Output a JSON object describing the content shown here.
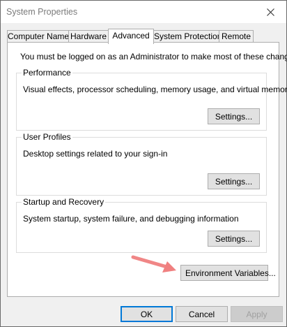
{
  "window": {
    "title": "System Properties"
  },
  "icons": {
    "close": "close-icon",
    "arrow": "pointer-arrow-icon"
  },
  "colors": {
    "arrow": "#f08080",
    "focus": "#0078d7"
  },
  "tabs": [
    {
      "label": "Computer Name",
      "active": false
    },
    {
      "label": "Hardware",
      "active": false
    },
    {
      "label": "Advanced",
      "active": true
    },
    {
      "label": "System Protection",
      "active": false
    },
    {
      "label": "Remote",
      "active": false
    }
  ],
  "advanced": {
    "notice": "You must be logged on as an Administrator to make most of these changes.",
    "performance": {
      "title": "Performance",
      "description": "Visual effects, processor scheduling, memory usage, and virtual memory",
      "button": "Settings..."
    },
    "user_profiles": {
      "title": "User Profiles",
      "description": "Desktop settings related to your sign-in",
      "button": "Settings..."
    },
    "startup_recovery": {
      "title": "Startup and Recovery",
      "description": "System startup, system failure, and debugging information",
      "button": "Settings..."
    },
    "env_button": "Environment Variables..."
  },
  "footer": {
    "ok": "OK",
    "cancel": "Cancel",
    "apply": "Apply"
  }
}
